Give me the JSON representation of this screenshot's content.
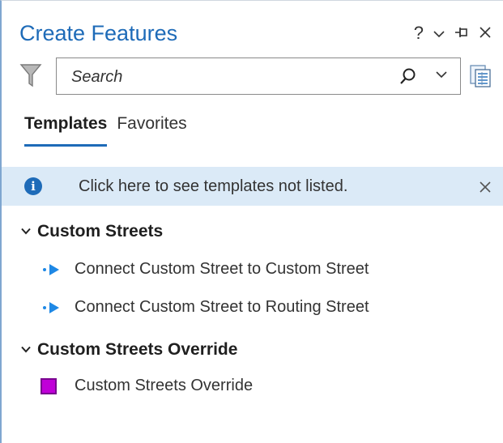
{
  "pane": {
    "title": "Create Features",
    "controls": {
      "help": "?",
      "options": "⌄",
      "pin": "⊣",
      "close": "✕"
    }
  },
  "search": {
    "placeholder": "Search",
    "value": ""
  },
  "tabs": [
    {
      "label": "Templates",
      "active": true
    },
    {
      "label": "Favorites",
      "active": false
    }
  ],
  "info_bar": {
    "icon": "i",
    "text": "Click here to see templates not listed.",
    "close": "✕"
  },
  "groups": [
    {
      "name": "Custom Streets",
      "items": [
        {
          "label": "Connect Custom Street to Custom Street",
          "symbol": "line"
        },
        {
          "label": "Connect Custom Street to Routing Street",
          "symbol": "line"
        }
      ]
    },
    {
      "name": "Custom Streets Override",
      "items": [
        {
          "label": "Custom Streets Override",
          "symbol": "polygon"
        }
      ]
    }
  ],
  "colors": {
    "accent": "#1e6bb8",
    "info_background": "#dbeaf7",
    "polygon_fill": "#c000d8"
  }
}
